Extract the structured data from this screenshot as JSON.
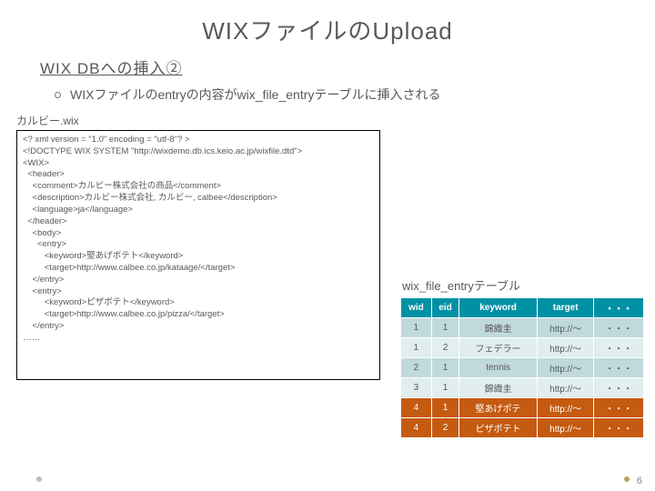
{
  "title": "WIXファイルのUpload",
  "subhead": "WIX DBへの挿入②",
  "bullet": "WIXファイルのentryの内容がwix_file_entryテーブルに挿入される",
  "filename": "カルビー.wix",
  "xml": "<? xml version = \"1.0\" encoding = \"utf-8\"? >\n<!DOCTYPE WIX SYSTEM \"http://wixdemo.db.ics.keio.ac.jp/wixfile.dtd\">\n<WIX>\n  <header>\n    <comment>カルビー株式会社の商品</comment>\n    <description>カルビー株式会社, カルビー, calbee</description>\n    <language>ja</language>\n  </header>\n    <body>\n      <entry>\n         <keyword>堅あげポテト</keyword>\n         <target>http://www.calbee.co.jp/kataage/</target>\n    </entry>\n    <entry>\n         <keyword>ピザポテト</keyword>\n         <target>http://www.calbee.co.jp/pizza/</target>\n    </entry>\n……",
  "table": {
    "caption": "wix_file_entryテーブル",
    "head": [
      "wid",
      "eid",
      "keyword",
      "target",
      "・・・"
    ],
    "rows": [
      {
        "c": [
          "1",
          "1",
          "錦織圭",
          "http://～",
          "・・・"
        ],
        "hl": false
      },
      {
        "c": [
          "1",
          "2",
          "フェデラー",
          "http://～",
          "・・・"
        ],
        "hl": false
      },
      {
        "c": [
          "2",
          "1",
          "tennis",
          "http://～",
          "・・・"
        ],
        "hl": false
      },
      {
        "c": [
          "3",
          "1",
          "錦織圭",
          "http://～",
          "・・・"
        ],
        "hl": false
      },
      {
        "c": [
          "4",
          "1",
          "堅あげポテ",
          "http://～",
          "・・・"
        ],
        "hl": true
      },
      {
        "c": [
          "4",
          "2",
          "ピザポテト",
          "http://～",
          "・・・"
        ],
        "hl": true
      }
    ]
  },
  "page": "6"
}
